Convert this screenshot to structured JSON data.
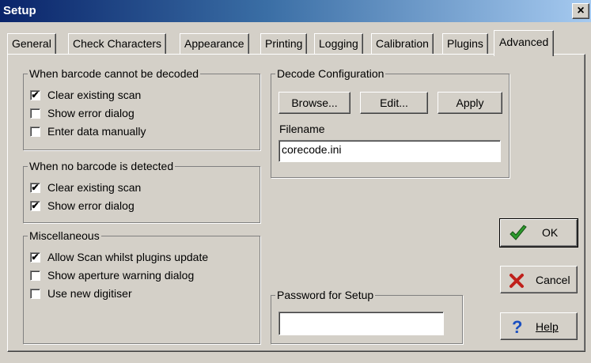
{
  "window": {
    "title": "Setup",
    "close_label": "×"
  },
  "tabs": [
    {
      "label": "General"
    },
    {
      "label": "Check Characters"
    },
    {
      "label": "Appearance"
    },
    {
      "label": "Printing"
    },
    {
      "label": "Logging"
    },
    {
      "label": "Calibration"
    },
    {
      "label": "Plugins"
    },
    {
      "label": "Advanced",
      "active": true
    }
  ],
  "groups": {
    "not_decoded": {
      "legend": "When barcode cannot be decoded",
      "items": [
        {
          "label": "Clear existing scan",
          "checked": true
        },
        {
          "label": "Show error dialog",
          "checked": false
        },
        {
          "label": "Enter data manually",
          "checked": false
        }
      ]
    },
    "not_detected": {
      "legend": "When no barcode is detected",
      "items": [
        {
          "label": "Clear existing scan",
          "checked": true
        },
        {
          "label": "Show error dialog",
          "checked": true
        }
      ]
    },
    "misc": {
      "legend": "Miscellaneous",
      "items": [
        {
          "label": "Allow Scan whilst plugins update",
          "checked": true
        },
        {
          "label": "Show aperture warning dialog",
          "checked": false
        },
        {
          "label": "Use new digitiser",
          "checked": false
        }
      ]
    },
    "decode_config": {
      "legend": "Decode Configuration",
      "browse_label": "Browse...",
      "edit_label": "Edit...",
      "apply_label": "Apply",
      "filename_label": "Filename",
      "filename_value": "corecode.ini"
    },
    "password": {
      "legend": "Password for Setup",
      "value": ""
    }
  },
  "actions": {
    "ok_label": "OK",
    "cancel_label": "Cancel",
    "help_label": "Help"
  },
  "icons": {
    "ok": "checkmark-icon",
    "cancel": "x-cross-icon",
    "help": "question-mark-icon",
    "check_glyph": "✔"
  },
  "colors": {
    "face": "#d4d0c8",
    "title_start": "#0a246a",
    "title_end": "#a6caf0",
    "ok_icon": "#2e9b2e",
    "cancel_icon": "#c0201a",
    "help_icon": "#1a4fc0"
  }
}
